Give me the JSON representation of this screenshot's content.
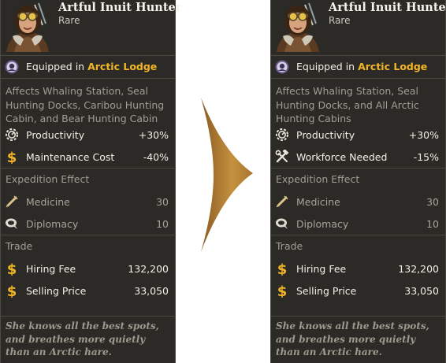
{
  "left_card": {
    "name": "Artful Inuit Hunter",
    "rarity": "Rare",
    "equipped_prefix": "Equipped in",
    "equipped_building": "Arctic Lodge",
    "affects": "Affects Whaling Station, Seal Hunting Docks, Caribou Hunting Cabin, and Bear Hunting Cabin",
    "stats": [
      {
        "label": "Productivity",
        "value": "+30%",
        "icon": "gear-icon"
      },
      {
        "label": "Maintenance Cost",
        "value": "-40%",
        "icon": "dollar-icon"
      }
    ],
    "expedition_title": "Expedition Effect",
    "expedition": [
      {
        "label": "Medicine",
        "value": "30",
        "icon": "syringe-icon"
      },
      {
        "label": "Diplomacy",
        "value": "10",
        "icon": "speech-bubble-icon"
      }
    ],
    "trade_title": "Trade",
    "trade": [
      {
        "label": "Hiring Fee",
        "value": "132,200",
        "icon": "dollar-icon"
      },
      {
        "label": "Selling Price",
        "value": "33,050",
        "icon": "dollar-icon"
      }
    ],
    "quote": "She knows all the best spots, and breathes more quietly than an Arctic hare."
  },
  "right_card": {
    "name": "Artful Inuit Hunter",
    "rarity": "Rare",
    "equipped_prefix": "Equipped in",
    "equipped_building": "Arctic Lodge",
    "affects": "Affects Whaling Station, Seal Hunting Docks, and All Arctic Hunting Cabins",
    "stats": [
      {
        "label": "Productivity",
        "value": "+30%",
        "icon": "gear-icon"
      },
      {
        "label": "Workforce Needed",
        "value": "-15%",
        "icon": "hammer-wrench-icon"
      }
    ],
    "expedition_title": "Expedition Effect",
    "expedition": [
      {
        "label": "Medicine",
        "value": "30",
        "icon": "syringe-icon"
      },
      {
        "label": "Diplomacy",
        "value": "10",
        "icon": "speech-bubble-icon"
      }
    ],
    "trade_title": "Trade",
    "trade": [
      {
        "label": "Hiring Fee",
        "value": "132,200",
        "icon": "dollar-icon"
      },
      {
        "label": "Selling Price",
        "value": "33,050",
        "icon": "dollar-icon"
      }
    ],
    "quote": "She knows all the best spots, and breathes more quietly than an Arctic hare."
  },
  "colors": {
    "card_bg": "#2b2a27",
    "accent_gold": "#f2b624",
    "arrow": "#b98636"
  }
}
